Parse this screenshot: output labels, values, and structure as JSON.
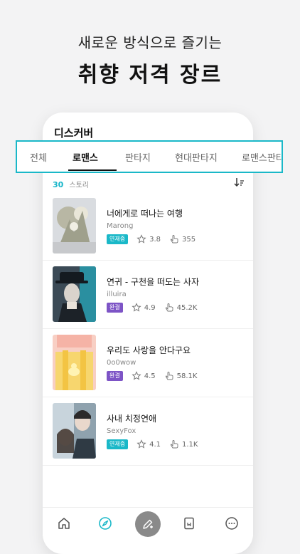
{
  "promo": {
    "subtitle": "새로운 방식으로 즐기는",
    "title": "취향 저격 장르"
  },
  "screen": {
    "title": "디스커버"
  },
  "genre_tabs": [
    {
      "label": "전체",
      "active": false
    },
    {
      "label": "로맨스",
      "active": true
    },
    {
      "label": "판타지",
      "active": false
    },
    {
      "label": "현대판타지",
      "active": false
    },
    {
      "label": "로맨스판타지",
      "active": false
    }
  ],
  "story_count": {
    "count": "30",
    "label": "스토리"
  },
  "stories": [
    {
      "title": "너에게로 떠나는 여행",
      "author": "Marong",
      "status": "연재중",
      "status_color": "#1ab8c8",
      "rating": "3.8",
      "views": "355"
    },
    {
      "title": "연귀 - 구천을 떠도는 사자",
      "author": "illuira",
      "status": "완결",
      "status_color": "#7d54c6",
      "rating": "4.9",
      "views": "45.2K"
    },
    {
      "title": "우리도 사랑을 안다구요",
      "author": "0o0wow",
      "status": "완결",
      "status_color": "#7d54c6",
      "rating": "4.5",
      "views": "58.1K"
    },
    {
      "title": "사내 치정연애",
      "author": "SexyFox",
      "status": "연재중",
      "status_color": "#1ab8c8",
      "rating": "4.1",
      "views": "1.1K"
    }
  ],
  "colors": {
    "accent": "#1ab8c8",
    "ongoing_badge": "#1ab8c8",
    "completed_badge": "#7d54c6"
  },
  "icons": {
    "sort": "sort-icon",
    "rating": "star-icon",
    "views": "hand-pointer-icon",
    "nav": [
      "home-icon",
      "compass-icon",
      "write-icon",
      "book-icon",
      "chat-icon"
    ]
  }
}
